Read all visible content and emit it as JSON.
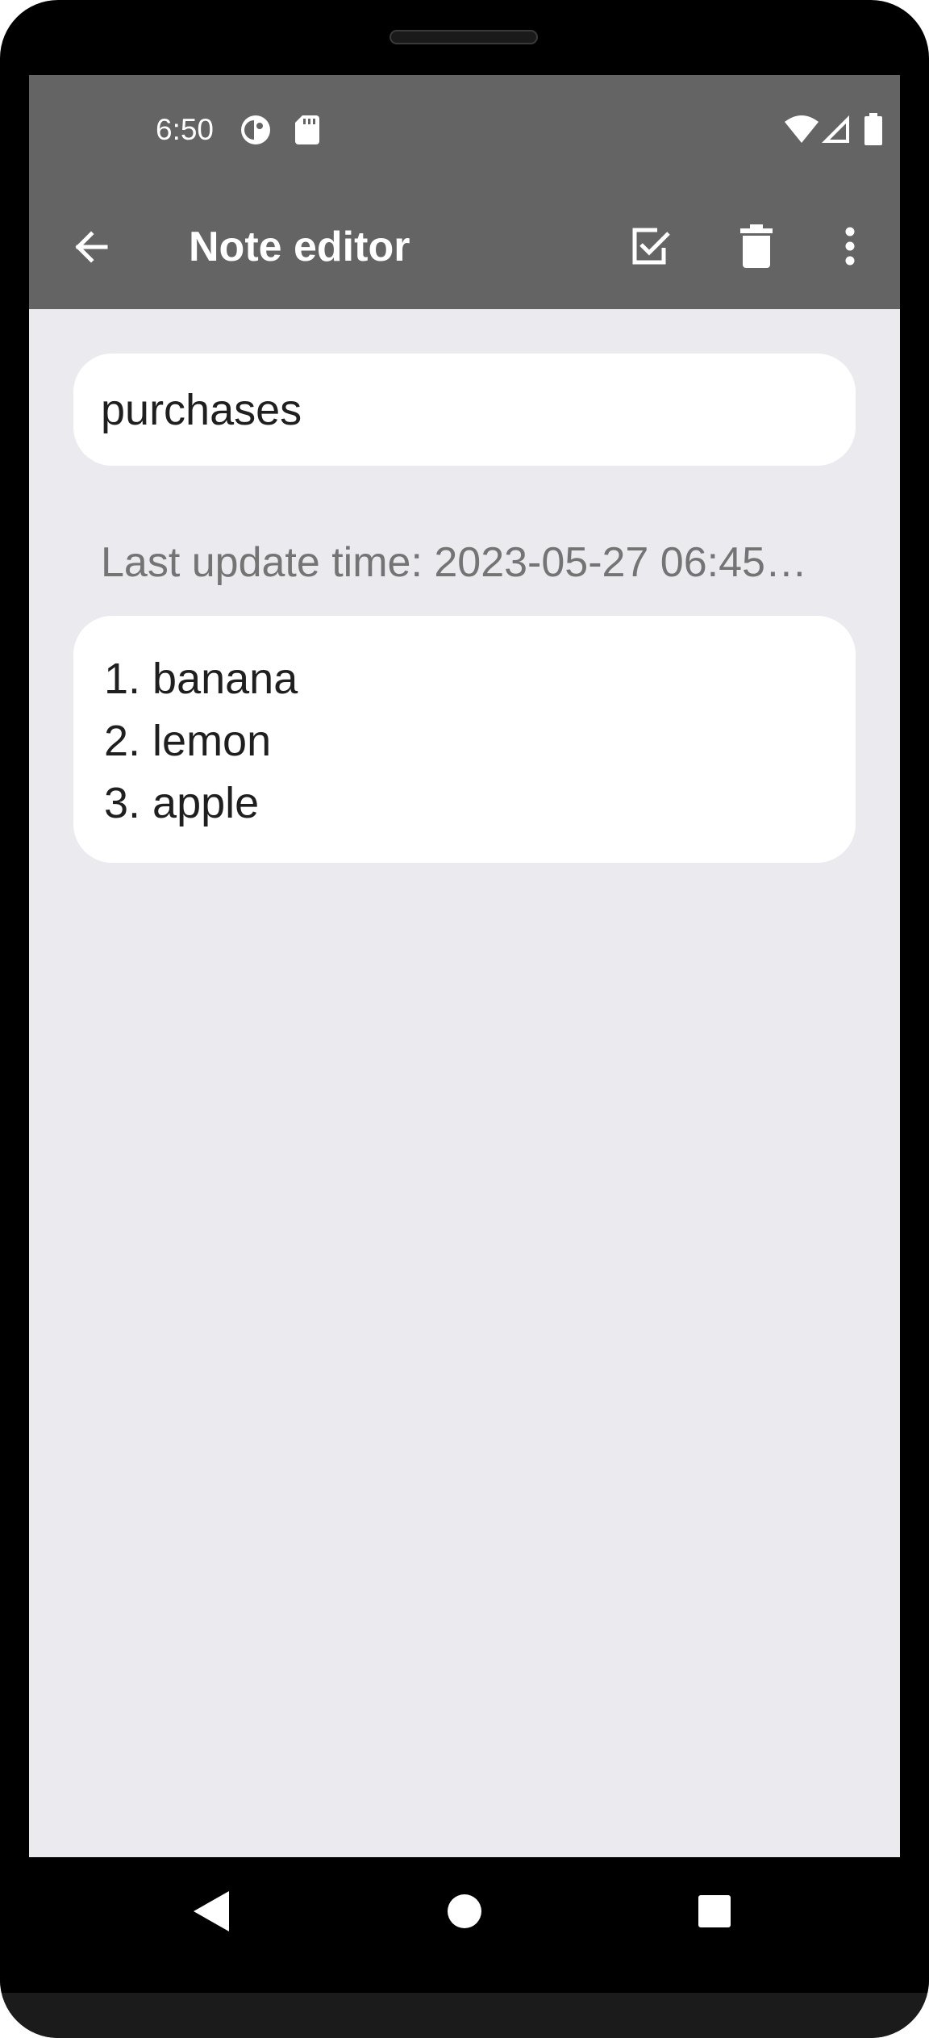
{
  "status_bar": {
    "time": "6:50",
    "left_icons": [
      "data-saver-icon",
      "sd-card-icon"
    ],
    "right_icons": [
      "wifi-icon",
      "cell-signal-icon",
      "battery-icon"
    ]
  },
  "app_bar": {
    "title": "Note editor",
    "back_icon": "arrow-back-icon",
    "actions": [
      "checkbox-icon",
      "trash-icon",
      "more-vert-icon"
    ]
  },
  "note": {
    "title_value": "purchases",
    "last_update": "Last update time: 2023-05-27 06:45…",
    "body_lines": [
      "1. banana",
      "2. lemon",
      "3. apple"
    ]
  },
  "nav_bar": {
    "buttons": [
      "back-triangle-icon",
      "home-circle-icon",
      "recents-square-icon"
    ]
  },
  "colors": {
    "app_bar": "#646464",
    "background": "#ebeaef",
    "card": "#ffffff",
    "muted_text": "#747474",
    "text": "#1f1f1f"
  }
}
